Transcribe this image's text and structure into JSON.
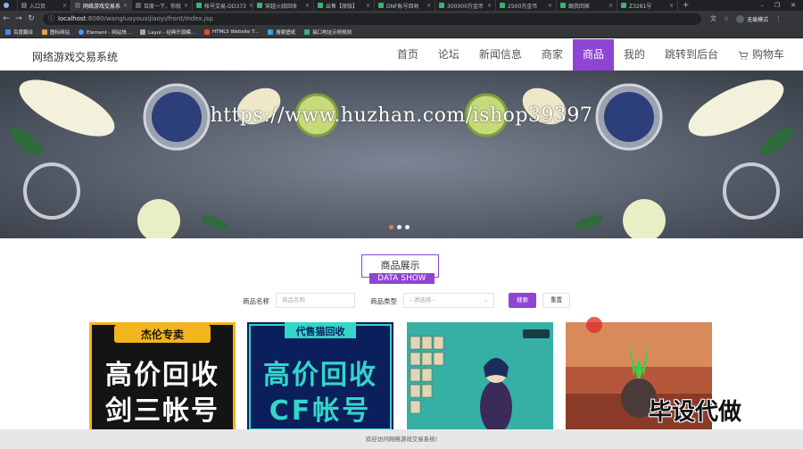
{
  "browser": {
    "tabs": [
      {
        "label": "",
        "icon": "chrome-icon"
      },
      {
        "label": "入口页",
        "icon": "page-icon"
      },
      {
        "label": "网络游戏交易系",
        "icon": "page-icon",
        "active": true
      },
      {
        "label": "百度一下，你就",
        "icon": "page-icon"
      },
      {
        "label": "帐号交易-DD373",
        "icon": "d-icon"
      },
      {
        "label": "穿越火线回收",
        "icon": "d-icon"
      },
      {
        "label": "出售【原版】",
        "icon": "d-icon"
      },
      {
        "label": "DNF账号回收",
        "icon": "d-icon"
      },
      {
        "label": "300000万金币",
        "icon": "d-icon"
      },
      {
        "label": "2500万金币",
        "icon": "d-icon"
      },
      {
        "label": "跟我回家",
        "icon": "d-icon"
      },
      {
        "label": "Z3281号",
        "icon": "d-icon"
      }
    ],
    "new_tab": "+",
    "url_host": "localhost",
    "url_path": ":8080/wangluoyouxijiaoyi/front/index.jsp",
    "profile_label": "无痕模式",
    "bookmarks": [
      "百度翻译",
      "图标网站",
      "Element - 网站快...",
      "Layui - 经典开源模...",
      "HTML5 Website T...",
      "搜索壁纸",
      "接口地址示例规则"
    ]
  },
  "site": {
    "title": "网络游戏交易系统",
    "nav": [
      "首页",
      "论坛",
      "新闻信息",
      "商家",
      "商品",
      "我的",
      "跳转到后台"
    ],
    "nav_active_index": 4,
    "cart_label": "购物车",
    "accent": "#8e44d4"
  },
  "banner": {
    "watermark": "https://www.huzhan.com/ishop39397",
    "slide_count": 3,
    "active_slide": 1
  },
  "section": {
    "title_cn": "商品展示",
    "title_en": "DATA SHOW"
  },
  "search": {
    "name_label": "商品名称",
    "name_placeholder": "商品名称",
    "type_label": "商品类型",
    "type_placeholder": "--请选择--",
    "search_btn": "搜索",
    "reset_btn": "重置"
  },
  "products": [
    {
      "tag": "杰伦专卖",
      "line1": "高价回收",
      "line2": "剑三帐号"
    },
    {
      "tag": "代售猫回收",
      "line1": "高价回收",
      "line2": "CF帐号"
    },
    {
      "image": "game-character-screenshot"
    },
    {
      "image": "game-scene-screenshot"
    }
  ],
  "corner_watermark": "毕设代做",
  "footer": "欢迎访问网络游戏交易系统!"
}
